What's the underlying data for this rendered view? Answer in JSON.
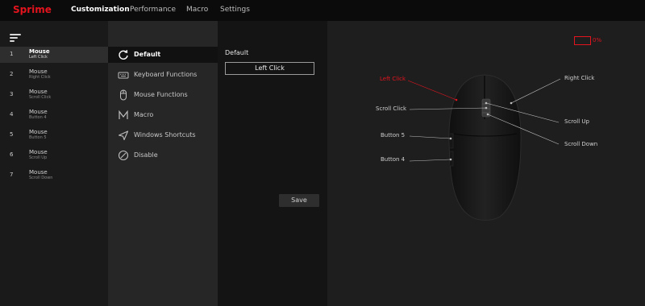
{
  "app": {
    "brand": "Sprime",
    "nav": [
      "Customization",
      "Performance",
      "Macro",
      "Settings"
    ],
    "active_nav": "Customization"
  },
  "buttons": [
    {
      "num": "1",
      "title": "Mouse",
      "sub": "Left Click",
      "active": true
    },
    {
      "num": "2",
      "title": "Mouse",
      "sub": "Right Click",
      "active": false
    },
    {
      "num": "3",
      "title": "Mouse",
      "sub": "Scroll Click",
      "active": false
    },
    {
      "num": "4",
      "title": "Mouse",
      "sub": "Button 4",
      "active": false
    },
    {
      "num": "5",
      "title": "Mouse",
      "sub": "Button 5",
      "active": false
    },
    {
      "num": "6",
      "title": "Mouse",
      "sub": "Scroll Up",
      "active": false
    },
    {
      "num": "7",
      "title": "Mouse",
      "sub": "Scroll Down",
      "active": false
    }
  ],
  "functions": [
    {
      "label": "Default",
      "icon": "refresh-icon",
      "active": true
    },
    {
      "label": "Keyboard Functions",
      "icon": "keyboard-icon",
      "active": false
    },
    {
      "label": "Mouse Functions",
      "icon": "mouse-icon",
      "active": false
    },
    {
      "label": "Macro",
      "icon": "macro-m-icon",
      "active": false
    },
    {
      "label": "Windows Shortcuts",
      "icon": "send-arrow-icon",
      "active": false
    },
    {
      "label": "Disable",
      "icon": "disable-icon",
      "active": false
    }
  ],
  "detail": {
    "title": "Default",
    "action": "Left Click",
    "save_label": "Save"
  },
  "device": {
    "battery": "0%"
  },
  "callouts": {
    "left_click": "Left Click",
    "right_click": "Right Click",
    "scroll_click": "Scroll Click",
    "scroll_up": "Scroll Up",
    "scroll_down": "Scroll Down",
    "button5": "Button 5",
    "button4": "Button 4"
  },
  "colors": {
    "accent": "#e3141e",
    "background": "#1c1c1c",
    "topbar": "#0b0b0b"
  }
}
